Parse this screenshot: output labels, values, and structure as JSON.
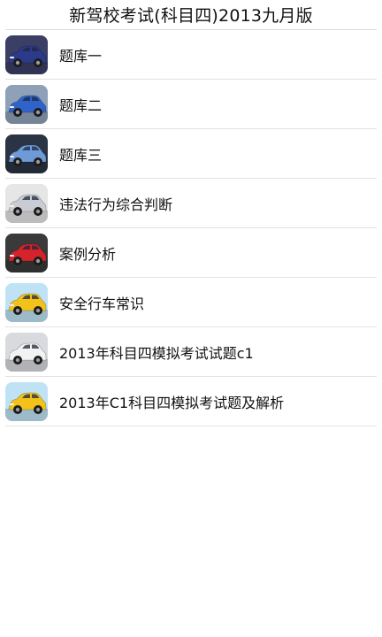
{
  "header": {
    "title": "新驾校考试(科目四)2013九月版"
  },
  "items": [
    {
      "label": "题库一",
      "icon": "car-dark-blue-icon",
      "bg": "#3b3f66",
      "car": "#2c3a8a"
    },
    {
      "label": "题库二",
      "icon": "car-blue-icon",
      "bg": "#8fa1b8",
      "car": "#2f63c9"
    },
    {
      "label": "题库三",
      "icon": "car-blue-sedan-icon",
      "bg": "#2a3444",
      "car": "#6e9ad8"
    },
    {
      "label": "违法行为综合判断",
      "icon": "car-silver-icon",
      "bg": "#e6e6e6",
      "car": "#c9cdd3"
    },
    {
      "label": "案例分析",
      "icon": "car-red-icon",
      "bg": "#3a3a3a",
      "car": "#d5232b"
    },
    {
      "label": "安全行车常识",
      "icon": "car-yellow-icon",
      "bg": "#bfe3f5",
      "car": "#f2c21b"
    },
    {
      "label": "2013年科目四模拟考试试题c1",
      "icon": "car-white-icon",
      "bg": "#d8dadd",
      "car": "#f2f2f2"
    },
    {
      "label": "2013年C1科目四模拟考试题及解析",
      "icon": "car-yellow-icon",
      "bg": "#bfe3f5",
      "car": "#f2c21b"
    }
  ]
}
